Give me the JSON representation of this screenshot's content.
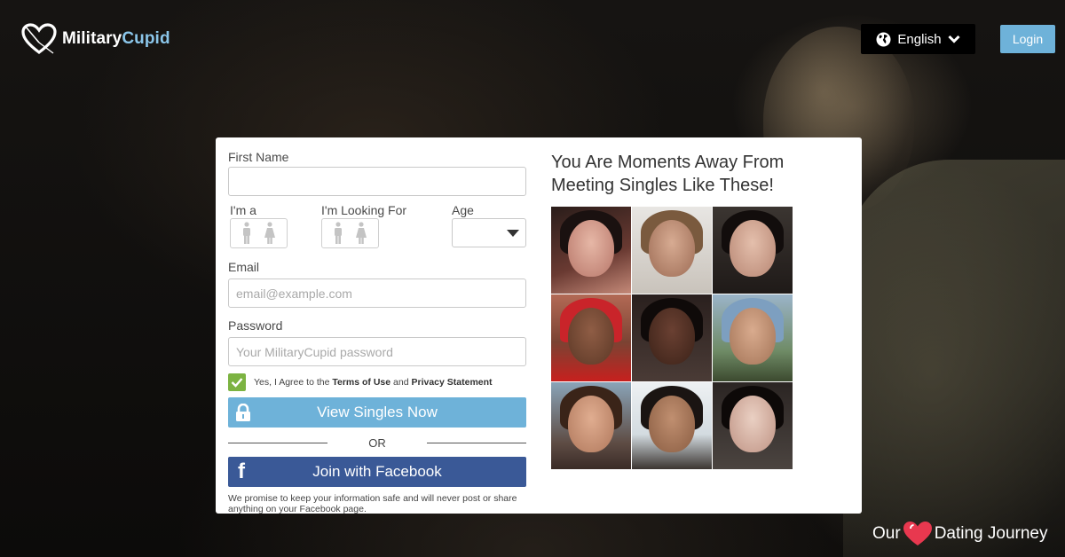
{
  "header": {
    "logo": {
      "part1": "Military",
      "part2": "Cupid"
    },
    "language": "English",
    "login": "Login"
  },
  "form": {
    "first_name_label": "First Name",
    "first_name_value": "",
    "im_a_label": "I'm a",
    "looking_for_label": "I'm Looking For",
    "age_label": "Age",
    "email_label": "Email",
    "email_placeholder": "email@example.com",
    "password_label": "Password",
    "password_placeholder": "Your MilitaryCupid password",
    "agree_prefix": "Yes, I Agree to the",
    "terms": "Terms of Use",
    "and": "and",
    "privacy": "Privacy Statement",
    "view_button": "View Singles Now",
    "or": "OR",
    "facebook_button": "Join with Facebook",
    "promise": "We promise to keep your information safe and will never post or share anything on your Facebook page."
  },
  "singles": {
    "headline": "You Are Moments Away From Meeting Singles Like These!"
  },
  "footer": {
    "word1": "Our",
    "word2": "Dating Journey"
  },
  "colors": {
    "accent_blue": "#6eb2d9",
    "facebook_blue": "#3a5997",
    "check_green": "#7cb342",
    "heart_red": "#e8384f"
  }
}
